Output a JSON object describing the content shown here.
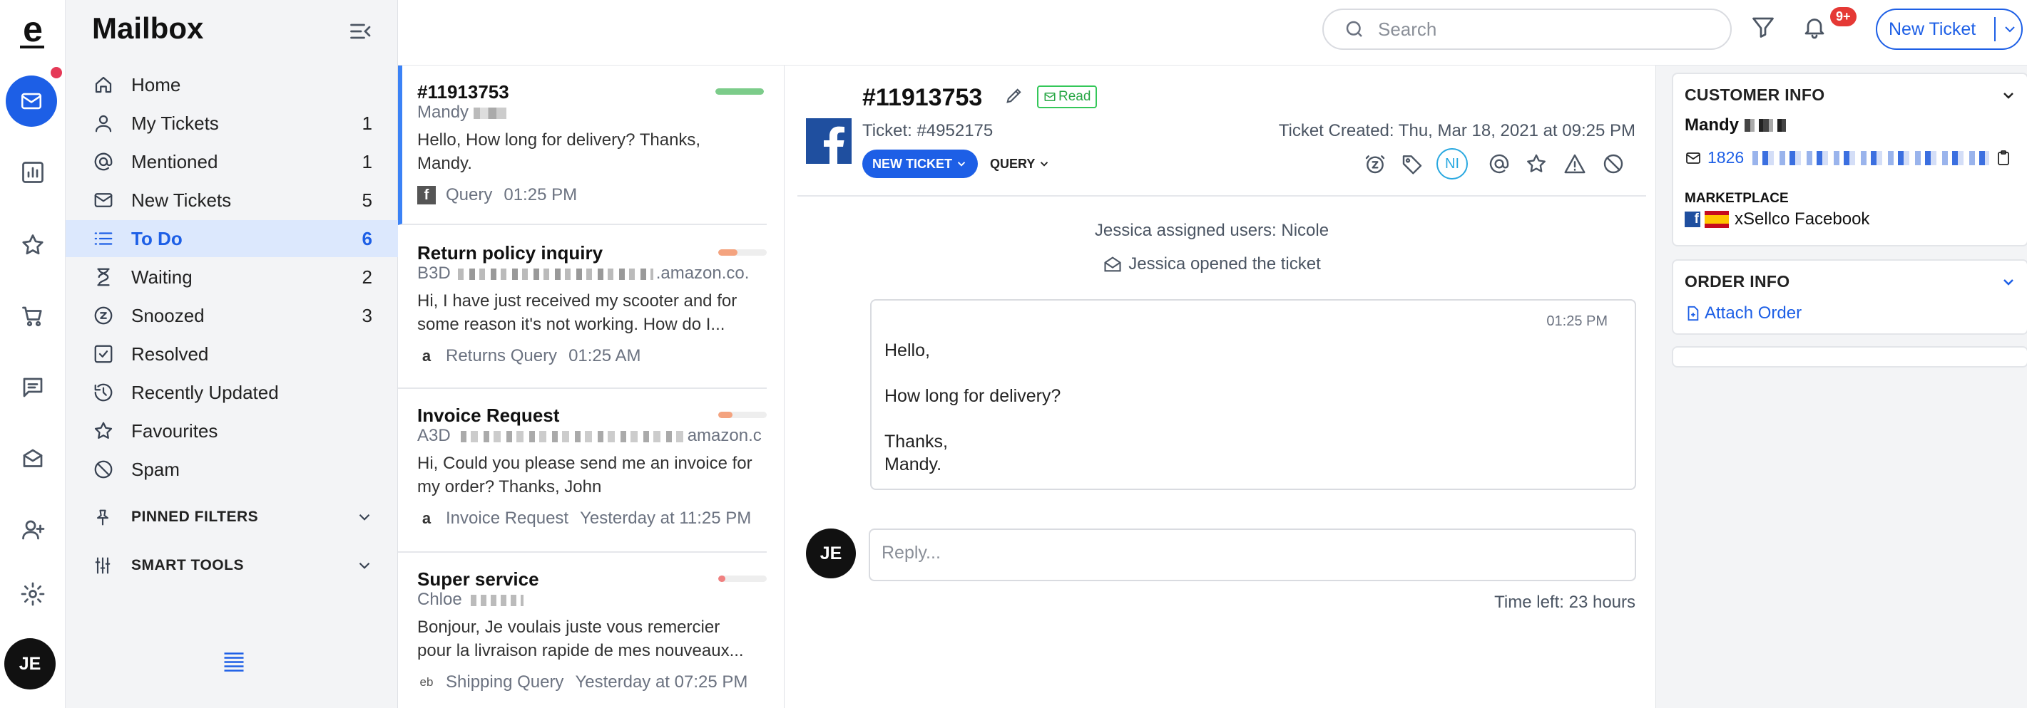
{
  "app": {
    "logo_letter": "e"
  },
  "rail": {
    "items": [
      "mail-icon",
      "reports-icon",
      "star-icon",
      "cart-icon",
      "chat-icon",
      "knowledge-icon",
      "add-user-icon",
      "settings-icon"
    ],
    "user_initials": "JE",
    "accent": "#1d5fe6",
    "dot_color": "#e53957"
  },
  "sidebar": {
    "title": "Mailbox",
    "items": [
      {
        "label": "Home",
        "count": ""
      },
      {
        "label": "My Tickets",
        "count": "1"
      },
      {
        "label": "Mentioned",
        "count": "1"
      },
      {
        "label": "New Tickets",
        "count": "5"
      },
      {
        "label": "To Do",
        "count": "6"
      },
      {
        "label": "Waiting",
        "count": "2"
      },
      {
        "label": "Snoozed",
        "count": "3"
      },
      {
        "label": "Resolved",
        "count": ""
      },
      {
        "label": "Recently Updated",
        "count": ""
      },
      {
        "label": "Favourites",
        "count": ""
      },
      {
        "label": "Spam",
        "count": ""
      }
    ],
    "pinned_filters": "PINNED FILTERS",
    "smart_tools": "SMART TOOLS"
  },
  "topbar": {
    "search_placeholder": "Search",
    "notif_badge": "9+",
    "new_ticket": "New Ticket"
  },
  "tickets": [
    {
      "title": "#11913753",
      "from": "Mandy",
      "body": "Hello, How long for delivery? Thanks, Mandy.",
      "source": "facebook",
      "type": "Query",
      "time": "01:25 PM",
      "priority": 1.0,
      "priority_color": "#7ccc8a"
    },
    {
      "title": "Return policy inquiry",
      "from": "B3D",
      "from_suffix": ".amazon.co.",
      "body": "Hi, I have just received my scooter and for some reason it's not working. How do I...",
      "source": "amazon",
      "type": "Returns Query",
      "time": "01:25 AM",
      "priority": 0.4,
      "priority_color": "#f4a37f"
    },
    {
      "title": "Invoice Request",
      "from": "A3D",
      "from_suffix": "amazon.c",
      "body": "Hi, Could you please send me an invoice for my order? Thanks, John",
      "source": "amazon",
      "type": "Invoice Request",
      "time": "Yesterday at 11:25 PM",
      "priority": 0.3,
      "priority_color": "#f4a37f"
    },
    {
      "title": "Super service",
      "from": "Chloe",
      "body": "Bonjour, Je voulais juste vous remercier pour la livraison rapide de mes nouveaux...",
      "source": "ebay",
      "type": "Shipping Query",
      "time": "Yesterday at 07:25 PM",
      "priority": 0.15,
      "priority_color": "#f08080"
    }
  ],
  "conversation": {
    "title": "#11913753",
    "read_badge": "Read",
    "ticket_number": "Ticket: #4952175",
    "created": "Ticket Created: Thu, Mar 18, 2021 at 09:25 PM",
    "new_ticket_pill": "NEW TICKET",
    "query_dropdown": "QUERY",
    "assignee_initials": "NI",
    "events": [
      "Jessica assigned users: Nicole",
      "Jessica opened the ticket"
    ],
    "message": {
      "time": "01:25 PM",
      "body": "Hello,\n\nHow long for delivery?\n\nThanks,\nMandy."
    },
    "reply_avatar": "JE",
    "reply_placeholder": "Reply...",
    "time_left": "Time left: 23 hours"
  },
  "customer_info": {
    "header": "CUSTOMER INFO",
    "name": "Mandy",
    "id_prefix": "1826",
    "marketplace_label": "MARKETPLACE",
    "marketplace": "xSellco Facebook"
  },
  "order_info": {
    "header": "ORDER INFO",
    "attach_order": "Attach Order"
  }
}
